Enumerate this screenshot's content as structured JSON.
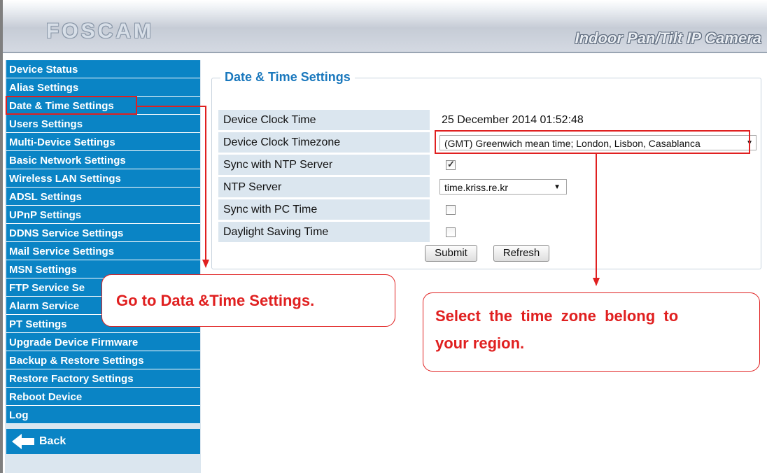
{
  "header": {
    "logo": "FOSCAM",
    "title": "Indoor Pan/Tilt IP Camera"
  },
  "sidebar": {
    "items": [
      {
        "label": "Device Status"
      },
      {
        "label": "Alias Settings"
      },
      {
        "label": "Date & Time Settings"
      },
      {
        "label": "Users Settings"
      },
      {
        "label": "Multi-Device Settings"
      },
      {
        "label": "Basic Network Settings"
      },
      {
        "label": "Wireless LAN Settings"
      },
      {
        "label": "ADSL Settings"
      },
      {
        "label": "UPnP Settings"
      },
      {
        "label": "DDNS Service Settings"
      },
      {
        "label": "Mail Service Settings"
      },
      {
        "label": "MSN Settings"
      },
      {
        "label": "FTP Service Se"
      },
      {
        "label": "Alarm Service"
      },
      {
        "label": "PT Settings"
      },
      {
        "label": "Upgrade Device Firmware"
      },
      {
        "label": "Backup & Restore Settings"
      },
      {
        "label": "Restore Factory Settings"
      },
      {
        "label": "Reboot Device"
      },
      {
        "label": "Log"
      }
    ],
    "back_label": "Back"
  },
  "panel": {
    "legend": "Date & Time Settings",
    "rows": {
      "clock_time": {
        "label": "Device Clock Time",
        "value": "25 December 2014 01:52:48"
      },
      "timezone": {
        "label": "Device Clock Timezone",
        "value": "(GMT) Greenwich mean time; London, Lisbon, Casablanca"
      },
      "ntp_sync": {
        "label": "Sync with NTP Server",
        "checked": true
      },
      "ntp_server": {
        "label": "NTP Server",
        "value": "time.kriss.re.kr"
      },
      "pc_sync": {
        "label": "Sync with PC Time",
        "checked": false
      },
      "dst": {
        "label": "Daylight Saving Time",
        "checked": false
      }
    },
    "submit_label": "Submit",
    "refresh_label": "Refresh"
  },
  "annotations": {
    "callout_left": "Go to Data &Time Settings.",
    "callout_right_line1": "Select  the  time  zone  belong  to",
    "callout_right_line2": "your region."
  },
  "colors": {
    "menu_blue": "#0a84c5",
    "label_bg": "#dbe6ef",
    "legend_blue": "#1a78bd",
    "annotation_red": "#e02020"
  },
  "icons": {
    "back": "left-arrow-icon",
    "dropdown": "chevron-down-icon"
  }
}
